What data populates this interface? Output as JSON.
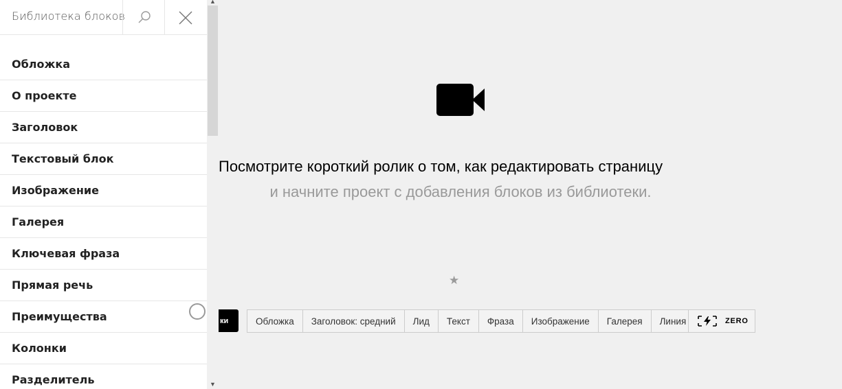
{
  "sidebar": {
    "title": "Библиотека блоков",
    "items": [
      {
        "label": "Обложка"
      },
      {
        "label": "О проекте"
      },
      {
        "label": "Заголовок"
      },
      {
        "label": "Текстовый блок"
      },
      {
        "label": "Изображение"
      },
      {
        "label": "Галерея"
      },
      {
        "label": "Ключевая фраза"
      },
      {
        "label": "Прямая речь"
      },
      {
        "label": "Преимущества"
      },
      {
        "label": "Колонки"
      },
      {
        "label": "Разделитель"
      }
    ]
  },
  "main": {
    "headline": "Посмотрите короткий ролик о том, как редактировать страницу",
    "subline": "и начните проект с добавления блоков из библиотеки.",
    "star_glyph": "★"
  },
  "toolbar": {
    "dark_tab_label": "ки",
    "buttons": [
      {
        "label": "Обложка"
      },
      {
        "label": "Заголовок: средний"
      },
      {
        "label": "Лид"
      },
      {
        "label": "Текст"
      },
      {
        "label": "Фраза"
      },
      {
        "label": "Изображение"
      },
      {
        "label": "Галерея"
      },
      {
        "label": "Линия"
      }
    ],
    "zero_label": "ZERO"
  },
  "icons": {
    "search": "search-icon",
    "close": "close-icon",
    "video": "video-camera-icon",
    "zero": "zero-block-icon"
  }
}
